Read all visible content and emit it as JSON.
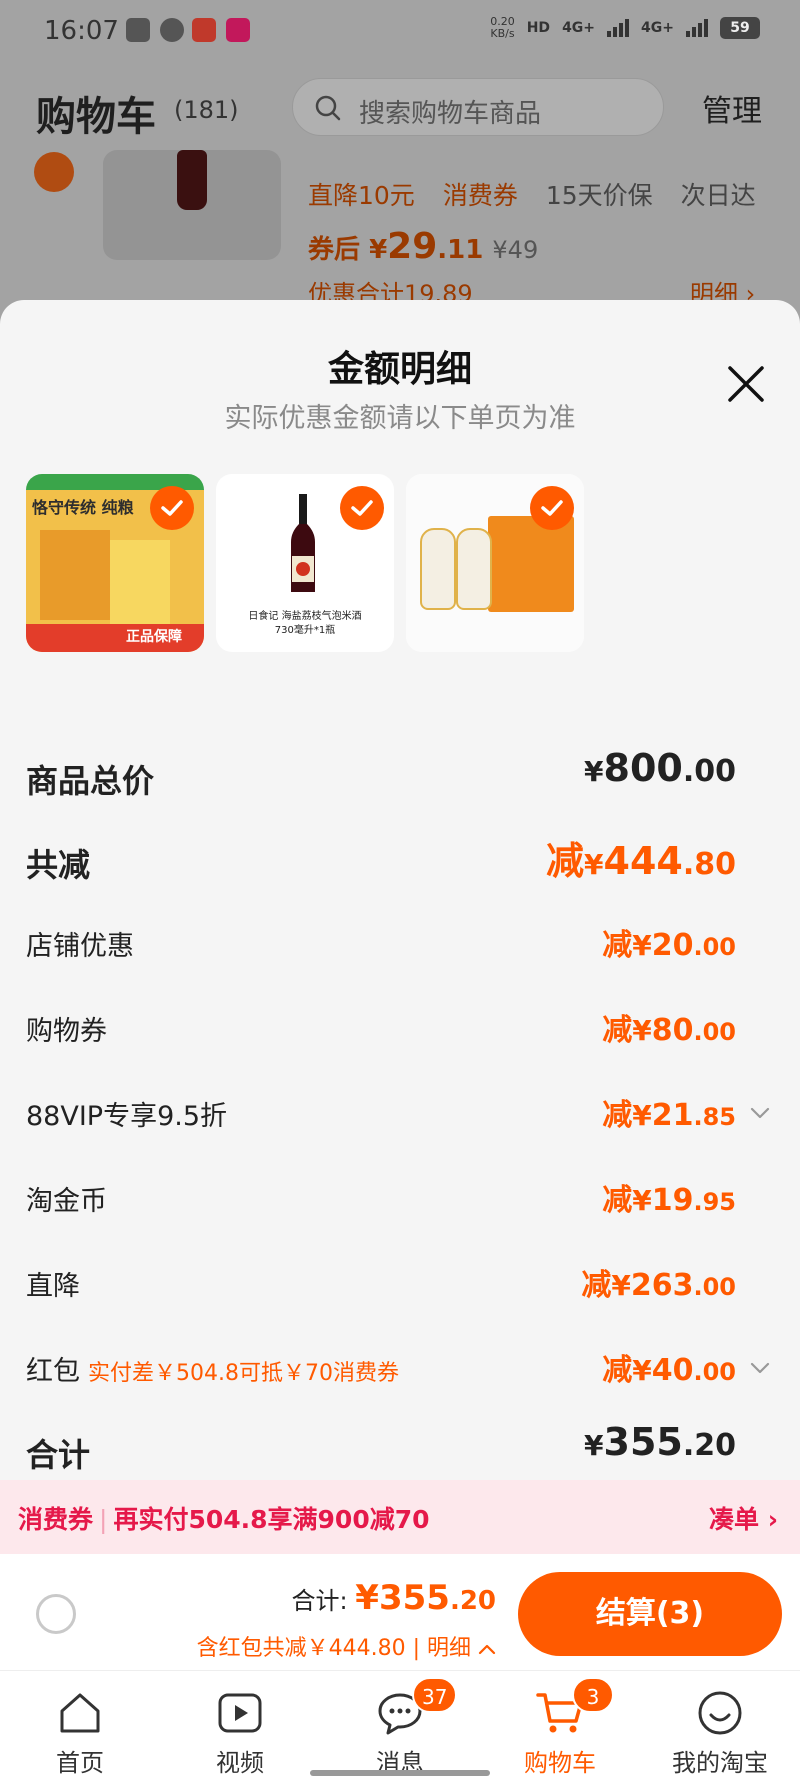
{
  "status_bar": {
    "time": "16:07",
    "net_speed_value": "0.20",
    "net_speed_unit": "KB/s",
    "hd_label": "HD",
    "network1": "4G+",
    "network2": "4G+",
    "battery": "59"
  },
  "header": {
    "title": "购物车",
    "count": "(181)",
    "search_placeholder": "搜索购物车商品",
    "manage_label": "管理"
  },
  "background_item": {
    "tags": [
      "直降10元",
      "消费券",
      "15天价保",
      "次日达"
    ],
    "price_prefix": "券后",
    "price_currency": "¥",
    "price_int": "29",
    "price_dec": ".11",
    "original_price": "¥49",
    "discount_total": "优惠合计19.89",
    "detail_link": "明细 ›"
  },
  "sheet": {
    "title": "金额明细",
    "subtitle": "实际优惠金额请以下单页为准",
    "products": [
      {
        "name": "恪守传统 纯粮",
        "badge": "正品保障"
      },
      {
        "name": "日食记 海盐荔枝气泡米酒",
        "spec": "730毫升*1瓶"
      },
      {
        "name": "白酒礼盒"
      }
    ],
    "rows": [
      {
        "label": "商品总价",
        "prefix": "",
        "currency": "¥",
        "int": "800",
        "dec": ".00"
      },
      {
        "label": "共减",
        "prefix": "减",
        "currency": "¥",
        "int": "444",
        "dec": ".80"
      },
      {
        "label": "店铺优惠",
        "prefix": "减",
        "currency": "¥",
        "int": "20",
        "dec": ".00"
      },
      {
        "label": "购物券",
        "prefix": "减",
        "currency": "¥",
        "int": "80",
        "dec": ".00"
      },
      {
        "label": "88VIP专享9.5折",
        "prefix": "减",
        "currency": "¥",
        "int": "21",
        "dec": ".85"
      },
      {
        "label": "淘金币",
        "prefix": "减",
        "currency": "¥",
        "int": "19",
        "dec": ".95"
      },
      {
        "label": "直降",
        "prefix": "减",
        "currency": "¥",
        "int": "263",
        "dec": ".00"
      },
      {
        "label": "红包",
        "hint": "实付差￥504.8可抵￥70消费券",
        "prefix": "减",
        "currency": "¥",
        "int": "40",
        "dec": ".00"
      },
      {
        "label": "合计",
        "prefix": "",
        "currency": "¥",
        "int": "355",
        "dec": ".20"
      }
    ]
  },
  "promo": {
    "tag": "消费券",
    "text": "再实付504.8享满900减70",
    "action": "凑单"
  },
  "checkout": {
    "total_label": "合计:",
    "currency": "¥",
    "total_int": "355",
    "total_dec": ".20",
    "savings_text": "含红包共减￥444.80",
    "detail_label": "明细",
    "button_label": "结算(3)"
  },
  "tabbar": [
    {
      "label": "首页",
      "icon": "home-icon"
    },
    {
      "label": "视频",
      "icon": "video-icon"
    },
    {
      "label": "消息",
      "icon": "message-icon",
      "badge": "37"
    },
    {
      "label": "购物车",
      "icon": "cart-icon",
      "badge": "3"
    },
    {
      "label": "我的淘宝",
      "icon": "profile-icon"
    }
  ],
  "colors": {
    "accent": "#ff5a00",
    "promo_red": "#e5194a",
    "promo_bg": "#fde8ec"
  }
}
